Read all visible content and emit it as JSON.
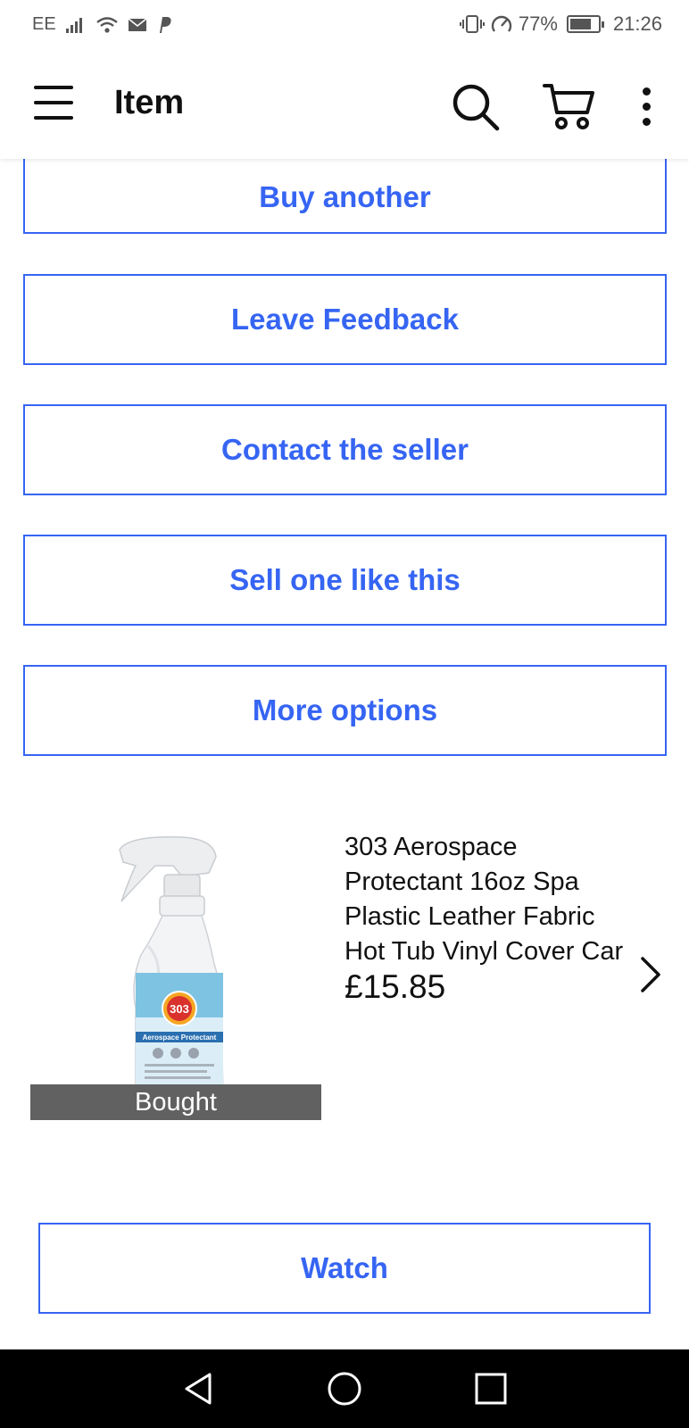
{
  "status_bar": {
    "carrier": "EE",
    "battery_percent": "77%",
    "battery_level": 0.77,
    "time": "21:26",
    "icons": [
      "signal-icon",
      "wifi-icon",
      "mail-icon",
      "paypal-icon",
      "vibrate-icon",
      "data-saver-icon",
      "battery-icon"
    ]
  },
  "app_bar": {
    "title": "Item",
    "icons": [
      "menu-icon",
      "search-icon",
      "cart-icon",
      "more-vertical-icon"
    ]
  },
  "actions": {
    "buy_another": "Buy another",
    "leave_feedback": "Leave Feedback",
    "contact_seller": "Contact the seller",
    "sell_one": "Sell one like this",
    "more_options": "More options"
  },
  "product": {
    "title": "303 Aerospace Protectant 16oz Spa Plastic Leather Fabric Hot Tub Vinyl Cover Car",
    "price": "£15.85",
    "badge": "Bought",
    "image_text": {
      "brand": "303",
      "name": "Aerospace Protectant"
    }
  },
  "watch": {
    "label": "Watch"
  },
  "nav_bar": {
    "icons": [
      "back-icon",
      "home-icon",
      "recents-icon"
    ]
  },
  "colors": {
    "accent": "#3665f3",
    "badge_bg": "#616161"
  }
}
